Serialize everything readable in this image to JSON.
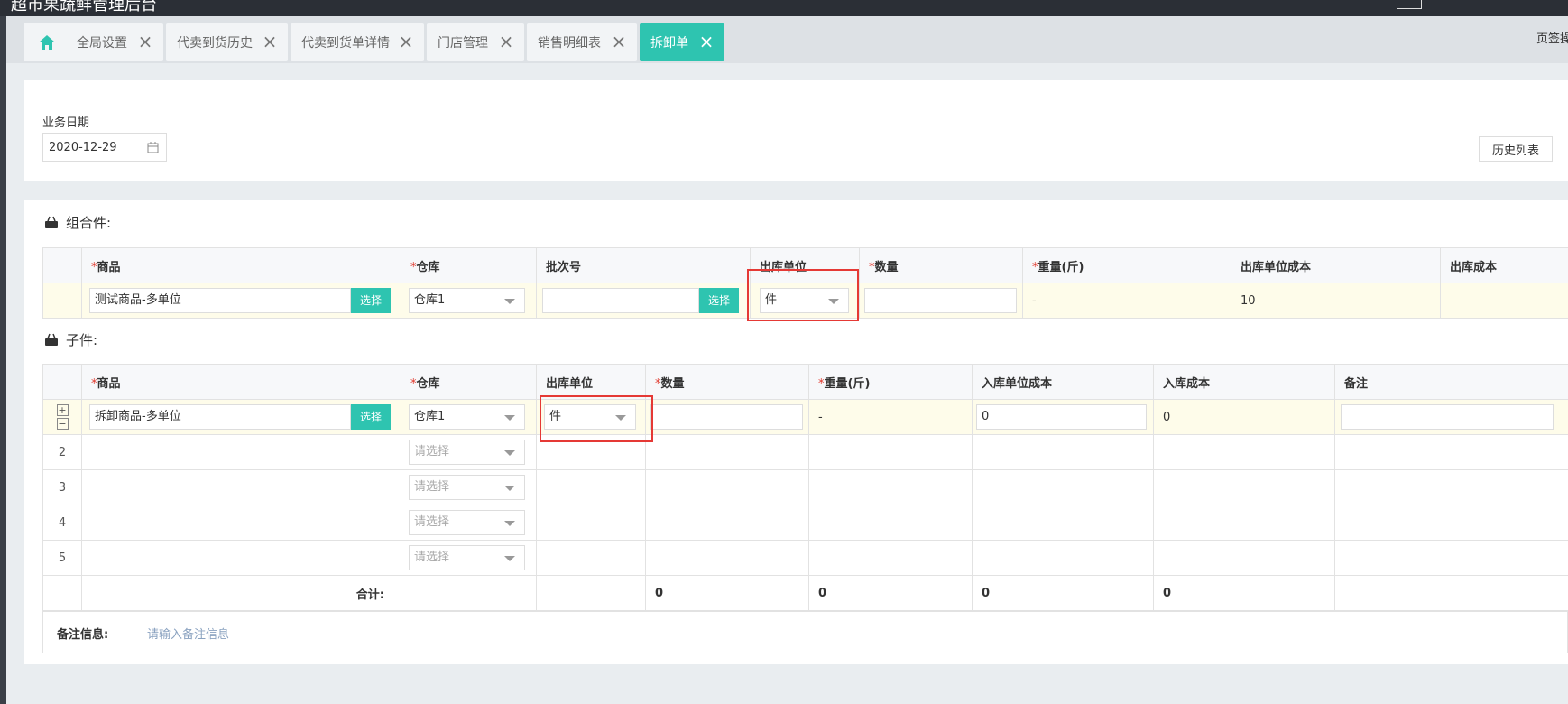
{
  "window": {
    "title": "超市果蔬鲜管理后台"
  },
  "tabs": [
    {
      "label": "全局设置"
    },
    {
      "label": "代卖到货历史"
    },
    {
      "label": "代卖到货单详情"
    },
    {
      "label": "门店管理"
    },
    {
      "label": "销售明细表"
    },
    {
      "label": "拆卸单"
    }
  ],
  "tab_right_label": "页签操作",
  "header": {
    "date_label": "业务日期",
    "date_value": "2020-12-29",
    "history_button": "历史列表"
  },
  "combo": {
    "title": "组合件:",
    "columns": [
      "商品",
      "仓库",
      "批次号",
      "出库单位",
      "数量",
      "重量(斤)",
      "出库单位成本",
      "出库成本"
    ],
    "required": [
      "*",
      "*",
      "",
      "",
      "*",
      "*",
      "",
      ""
    ],
    "row": {
      "product": "测试商品-多单位",
      "select_btn": "选择",
      "warehouse": "仓库1",
      "batch": "",
      "batch_btn": "选择",
      "unit": "件",
      "qty": "",
      "weight": "-",
      "unit_cost": "10",
      "cost": ""
    }
  },
  "child": {
    "title": "子件:",
    "columns": [
      "商品",
      "仓库",
      "出库单位",
      "数量",
      "重量(斤)",
      "入库单位成本",
      "入库成本",
      "备注"
    ],
    "required": [
      "*",
      "*",
      "",
      "*",
      "*",
      "",
      "",
      ""
    ],
    "row1": {
      "plus": "+",
      "minus": "−",
      "product": "拆卸商品-多单位",
      "select_btn": "选择",
      "warehouse": "仓库1",
      "unit": "件",
      "qty": "",
      "weight": "-",
      "unit_cost": "0",
      "cost": "0",
      "note": ""
    },
    "empty_rows": [
      {
        "num": "2",
        "warehouse_placeholder": "请选择"
      },
      {
        "num": "3",
        "warehouse_placeholder": "请选择"
      },
      {
        "num": "4",
        "warehouse_placeholder": "请选择"
      },
      {
        "num": "5",
        "warehouse_placeholder": "请选择"
      }
    ],
    "total": {
      "label": "合计:",
      "qty": "0",
      "weight": "0",
      "unit_cost": "0",
      "cost": "0"
    }
  },
  "remark": {
    "label": "备注信息:",
    "placeholder": "请输入备注信息"
  },
  "colors": {
    "accent": "#2ec4b0",
    "required": "#e0372b",
    "highlight_box": "#e53935",
    "row_highlight": "#fefcea"
  }
}
